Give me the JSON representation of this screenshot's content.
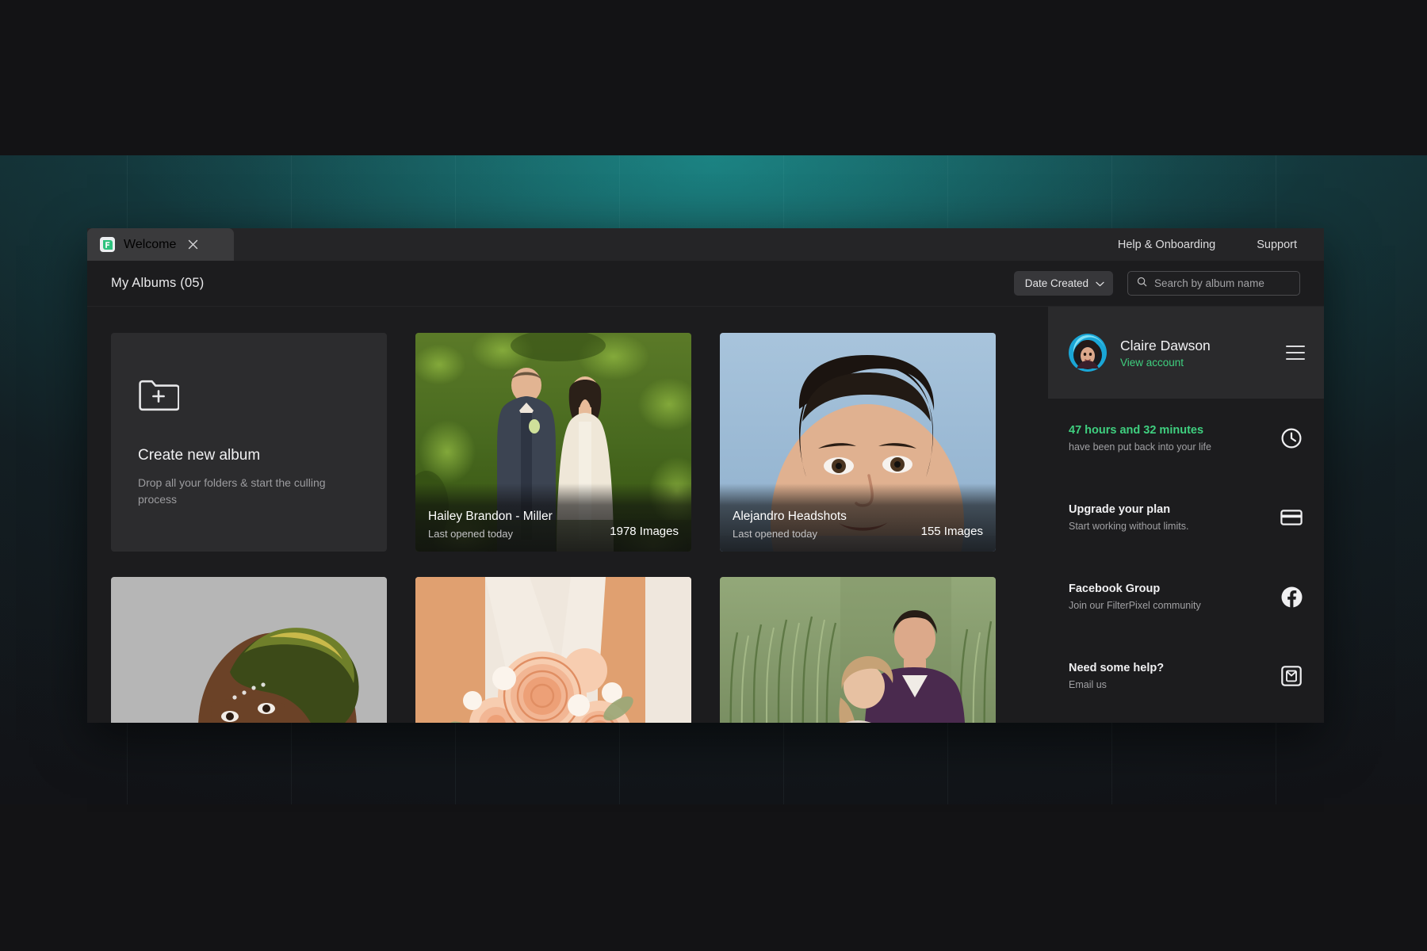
{
  "window": {
    "tab": {
      "label": "Welcome",
      "logo_icon": "filterpixel-logo-icon",
      "close_icon": "close-icon"
    },
    "header_links": [
      {
        "label": "Help & Onboarding"
      },
      {
        "label": "Support"
      }
    ]
  },
  "toolbar": {
    "title": "My Albums (05)",
    "sort": {
      "value": "Date Created",
      "chevron_icon": "chevron-down-icon"
    },
    "search": {
      "value": "",
      "placeholder": "Search by album name",
      "icon": "search-icon"
    }
  },
  "create_card": {
    "icon": "folder-plus-icon",
    "title": "Create new album",
    "subtitle": "Drop all your folders & start the culling process"
  },
  "albums": [
    {
      "name": "Hailey Brandon - Miller",
      "last_opened": "Last opened today",
      "count": "1978 Images",
      "thumb": "wedding-couple-garden"
    },
    {
      "name": "Alejandro Headshots",
      "last_opened": "Last opened today",
      "count": "155 Images",
      "thumb": "man-headshot-blue-backdrop"
    },
    {
      "name": "",
      "last_opened": "",
      "count": "",
      "thumb": "woman-headwrap-grey-backdrop"
    },
    {
      "name": "",
      "last_opened": "",
      "count": "",
      "thumb": "peach-rose-bouquet"
    },
    {
      "name": "",
      "last_opened": "",
      "count": "",
      "thumb": "couple-embrace-greenery"
    }
  ],
  "sidebar": {
    "profile": {
      "name": "Claire Dawson",
      "link": "View account",
      "avatar_icon": "avatar",
      "menu_icon": "hamburger-icon"
    },
    "items": [
      {
        "title": "47 hours and 32 minutes",
        "subtitle": "have been put back into your life",
        "icon": "clock-icon",
        "accent": true
      },
      {
        "title": "Upgrade your plan",
        "subtitle": "Start working without limits.",
        "icon": "credit-card-icon",
        "accent": false
      },
      {
        "title": "Facebook Group",
        "subtitle": "Join our FilterPixel community",
        "icon": "facebook-icon",
        "accent": false
      },
      {
        "title": "Need some help?",
        "subtitle": "Email us",
        "icon": "email-icon",
        "accent": false
      }
    ]
  },
  "colors": {
    "accent_green": "#3fcf7f",
    "window_bg": "#1c1c1e",
    "panel_bg": "#2a2a2c",
    "backdrop_teal": "#179696"
  }
}
